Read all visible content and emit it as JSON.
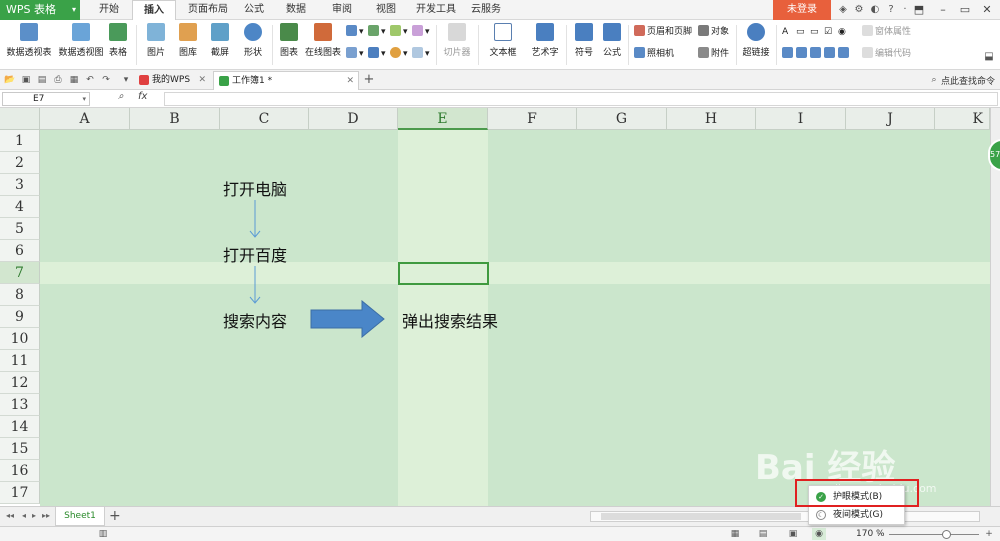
{
  "app": {
    "name": "WPS 表格",
    "login": "未登录"
  },
  "menu_tabs": [
    "开始",
    "插入",
    "页面布局",
    "公式",
    "数据",
    "审阅",
    "视图",
    "开发工具",
    "云服务"
  ],
  "ribbon": {
    "pivot_table": "数据透视表",
    "pivot_chart": "数据透视图",
    "table": "表格",
    "picture": "图片",
    "gallery": "图库",
    "screenshot": "截屏",
    "shapes": "形状",
    "chart": "图表",
    "online_chart": "在线图表",
    "slicer": "切片器",
    "textbox": "文本框",
    "wordart": "艺术字",
    "symbol": "符号",
    "formula": "公式",
    "header_footer": "页眉和页脚",
    "object": "对象",
    "camera": "照相机",
    "attachment": "附件",
    "hyperlink": "超链接",
    "form_properties": "窗体属性",
    "edit_code": "编辑代码"
  },
  "doc_tabs": [
    {
      "label": "我的WPS"
    },
    {
      "label": "工作簿1 *"
    }
  ],
  "search_placeholder": "点此查找命令",
  "formula_bar": {
    "cell_ref": "E7",
    "fx": "fx",
    "value": ""
  },
  "columns": [
    "A",
    "B",
    "C",
    "D",
    "E",
    "F",
    "G",
    "H",
    "I",
    "J",
    "K"
  ],
  "rows": [
    "1",
    "2",
    "3",
    "4",
    "5",
    "6",
    "7",
    "8",
    "9",
    "10",
    "11",
    "12",
    "13",
    "14",
    "15",
    "16",
    "17"
  ],
  "selected": {
    "column": "E",
    "row": "7"
  },
  "content": {
    "step1": "打开电脑",
    "step2": "打开百度",
    "step3": "搜索内容",
    "result": "弹出搜索结果"
  },
  "sheets": [
    {
      "name": "Sheet1"
    }
  ],
  "eye_menu": {
    "options": [
      "护眼模式(B)",
      "夜间模式(G)"
    ],
    "checked": "护眼模式(B)"
  },
  "zoom": "170 %",
  "watermark": {
    "text": "Bai 经验",
    "sub": "jingyan.baidu.com"
  },
  "colors": {
    "accent": "#3aa248",
    "grid_bg": "#cbe6cc",
    "highlight_bg": "#ddf0d8",
    "arrow": "#4a86c8",
    "login": "#e8603c",
    "annotation": "#e02020"
  }
}
